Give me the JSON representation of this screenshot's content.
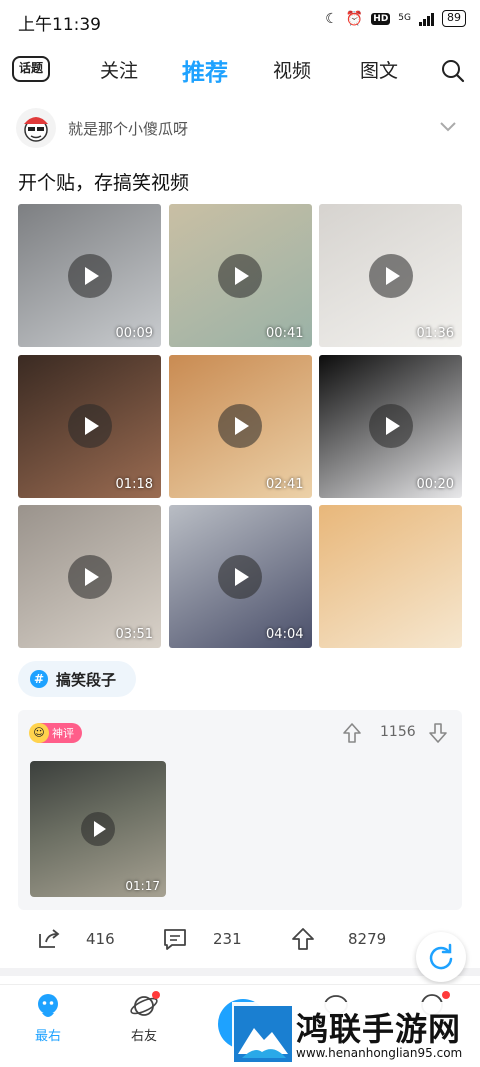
{
  "status_bar": {
    "time": "上午11:39",
    "hd": "HD",
    "network": "5G",
    "battery": "89"
  },
  "top_nav": {
    "topic_icon_label": "话题",
    "tabs": [
      {
        "label": "关注",
        "active": false
      },
      {
        "label": "推荐",
        "active": true
      },
      {
        "label": "视频",
        "active": false
      },
      {
        "label": "图文",
        "active": false
      }
    ]
  },
  "post": {
    "username": "就是那个小傻瓜呀",
    "title": "开个贴，存搞笑视频",
    "media": [
      {
        "duration": "00:09",
        "has_play": true,
        "colors": [
          "#7d7f82",
          "#c9cccf"
        ]
      },
      {
        "duration": "00:41",
        "has_play": true,
        "colors": [
          "#c9bfa4",
          "#9ab2a7"
        ]
      },
      {
        "duration": "01:36",
        "has_play": true,
        "colors": [
          "#d6d3cf",
          "#f2f1ee"
        ]
      },
      {
        "duration": "01:18",
        "has_play": true,
        "colors": [
          "#3a2a22",
          "#9b6c52"
        ]
      },
      {
        "duration": "02:41",
        "has_play": true,
        "colors": [
          "#c98b52",
          "#ecd1a8"
        ]
      },
      {
        "duration": "00:20",
        "has_play": true,
        "colors": [
          "#0c0c0c",
          "#e8e8ea"
        ]
      },
      {
        "duration": "03:51",
        "has_play": true,
        "colors": [
          "#9a938c",
          "#d8d1c8"
        ]
      },
      {
        "duration": "04:04",
        "has_play": true,
        "colors": [
          "#b9bdc4",
          "#4a4f6a"
        ]
      },
      {
        "duration": "",
        "has_play": false,
        "colors": [
          "#e8b77a",
          "#f6e7cf"
        ]
      }
    ],
    "tag": "搞笑段子"
  },
  "comment": {
    "badge": "神评",
    "votes": "1156",
    "video_duration": "01:17"
  },
  "actions": {
    "share": "416",
    "comment": "231",
    "like": "8279"
  },
  "bottom_nav": {
    "items": [
      {
        "label": "最右",
        "active": true
      },
      {
        "label": "右友",
        "active": false
      }
    ]
  },
  "watermark": {
    "title": "鸿联手游网",
    "url": "www.henanhonglian95.com"
  },
  "colors": {
    "accent": "#1ea2ff",
    "badge_pink": "#ff5e8a",
    "red_dot": "#ff3b3b"
  }
}
